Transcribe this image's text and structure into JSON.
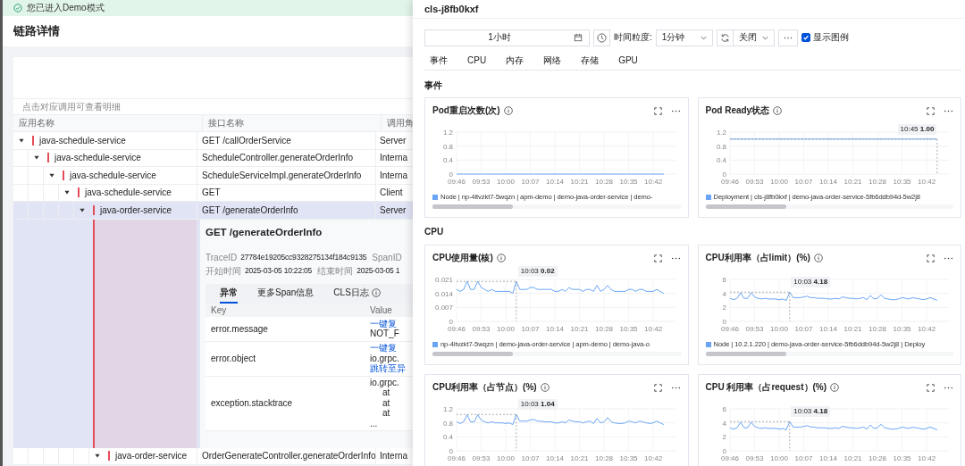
{
  "trace": {
    "banner": "您已进入Demo模式",
    "title": "链路详情",
    "hint": "点击对应调用可查看明细",
    "columns": [
      "应用名称",
      "接口名称",
      "调用角"
    ],
    "spans": [
      {
        "app": "java-schedule-service",
        "interface": "GET /callOrderService",
        "role": "Server",
        "expanded": true,
        "selected": false,
        "children": [
          {
            "app": "java-schedule-service",
            "interface": "ScheduleController.generateOrderInfo",
            "role": "Interna",
            "expanded": true,
            "selected": false,
            "children": [
              {
                "app": "java-schedule-service",
                "interface": "ScheduleServiceImpl.generateOrderInfo",
                "role": "Interna",
                "expanded": true,
                "selected": false,
                "children": [
                  {
                    "app": "java-schedule-service",
                    "interface": "GET",
                    "role": "Client",
                    "expanded": true,
                    "selected": false,
                    "children": [
                      {
                        "app": "java-order-service",
                        "interface": "GET /generateOrderInfo",
                        "role": "Server",
                        "expanded": true,
                        "selected": true,
                        "detail": {
                          "title": "GET /generateOrderInfo",
                          "meta": [
                            [
                              {
                                "label": "TraceID",
                                "value": "27784e19205cc9328275134f184c9135"
                              },
                              {
                                "label": "SpanID"
                              }
                            ],
                            [
                              {
                                "label": "开始时间",
                                "value": "2025-03-05 10:22:05"
                              },
                              {
                                "label": "结束时间",
                                "value": "2025-03-05 1"
                              }
                            ]
                          ],
                          "tabs": [
                            {
                              "label": "异常",
                              "selected": true
                            },
                            {
                              "label": "更多Span信息",
                              "selected": false
                            },
                            {
                              "label": "CLS日志",
                              "selected": false,
                              "info": true
                            }
                          ],
                          "columns": [
                            "Key",
                            "Value"
                          ],
                          "rows": [
                            {
                              "key": "error.message",
                              "value": [
                                {
                                  "kind": "link",
                                  "text": "一键复"
                                },
                                {
                                  "kind": "text",
                                  "text": "NOT_F"
                                }
                              ]
                            },
                            {
                              "key": "error.object",
                              "value": [
                                {
                                  "kind": "link",
                                  "text": "一键复"
                                },
                                {
                                  "kind": "text",
                                  "text": "io.grpc."
                                },
                                {
                                  "kind": "link",
                                  "text": "跳转至异"
                                }
                              ]
                            },
                            {
                              "key": "exception.stacktrace",
                              "value": [
                                {
                                  "kind": "text",
                                  "text": "io.grpc."
                                },
                                {
                                  "kind": "indent",
                                  "text": "at"
                                },
                                {
                                  "kind": "indent",
                                  "text": "at"
                                },
                                {
                                  "kind": "indent",
                                  "text": "at"
                                },
                                {
                                  "kind": "text",
                                  "text": "..."
                                }
                              ]
                            }
                          ]
                        },
                        "children": [
                          {
                            "app": "java-order-service",
                            "interface": "OrderGenerateController.generateOrderInfo",
                            "role": "Interna",
                            "expanded": true,
                            "selected": false
                          }
                        ]
                      }
                    ]
                  }
                ]
              }
            ]
          }
        ]
      }
    ]
  },
  "drawer": {
    "title": "cls-j8fb0kxf",
    "toolbar": {
      "time_range": "1小时",
      "granularity_label": "时间粒度:",
      "granularity": "1分钟",
      "auto_refresh": "关闭",
      "show_legend": {
        "label": "显示图例",
        "checked": true
      }
    },
    "tabs": [
      {
        "label": "事件",
        "selected": false
      },
      {
        "label": "CPU",
        "selected": false
      },
      {
        "label": "内存",
        "selected": false
      },
      {
        "label": "网络",
        "selected": false
      },
      {
        "label": "存储",
        "selected": false
      },
      {
        "label": "GPU",
        "selected": false
      }
    ],
    "sections": [
      {
        "title": "事件",
        "charts": [
          {
            "title": "Pod重启次数(次)",
            "chart_data": {
              "type": "line",
              "grid": true,
              "categories": [
                "09:46",
                null,
                null,
                null,
                null,
                null,
                null,
                "09:53",
                null,
                null,
                null,
                null,
                null,
                null,
                "10:00",
                null,
                null,
                null,
                null,
                null,
                null,
                "10:07",
                null,
                null,
                null,
                null,
                null,
                null,
                "10:14",
                null,
                null,
                null,
                null,
                null,
                null,
                "10:21",
                null,
                null,
                null,
                null,
                null,
                null,
                "10:28",
                null,
                null,
                null,
                null,
                null,
                null,
                "10:35",
                null,
                null,
                null,
                null,
                null,
                null,
                "10:42",
                null,
                null,
                null
              ],
              "series": [
                {
                  "name": "Node | np-4itvzkt7-5wqzn | apm-demo | demo-java-order-service | demo-",
                  "color": "#6aa5f5",
                  "values": [
                    0,
                    0,
                    0,
                    0,
                    0,
                    0,
                    0,
                    0,
                    0,
                    0,
                    0,
                    0,
                    0,
                    0,
                    0,
                    0,
                    0,
                    0,
                    0,
                    0,
                    0,
                    0,
                    0,
                    0,
                    0,
                    0,
                    0,
                    0,
                    0,
                    0,
                    0,
                    0,
                    0,
                    0,
                    0,
                    0,
                    0,
                    0,
                    0,
                    0,
                    0,
                    0,
                    0,
                    0,
                    0,
                    0,
                    0,
                    0,
                    0,
                    0,
                    0,
                    0,
                    0,
                    0,
                    0,
                    0,
                    0,
                    0,
                    0,
                    0
                  ]
                }
              ],
              "ylim": [
                0,
                1.2
              ],
              "yticks": [
                0,
                0.4,
                0.8,
                1.2
              ]
            }
          },
          {
            "title": "Pod Ready状态",
            "chart_data": {
              "type": "line",
              "grid": true,
              "categories": [
                "09:46",
                null,
                null,
                null,
                null,
                null,
                null,
                "09:53",
                null,
                null,
                null,
                null,
                null,
                null,
                "10:00",
                null,
                null,
                null,
                null,
                null,
                null,
                "10:07",
                null,
                null,
                null,
                null,
                null,
                null,
                "10:14",
                null,
                null,
                null,
                null,
                null,
                null,
                "10:21",
                null,
                null,
                null,
                null,
                null,
                null,
                "10:28",
                null,
                null,
                null,
                null,
                null,
                null,
                "10:35",
                null,
                null,
                null,
                null,
                null,
                null,
                "10:42",
                null,
                null,
                null
              ],
              "series": [
                {
                  "name": "Deployment | cls-j8fb0kxf | demo-java-order-service-5fb6ddb94d-5w2j8",
                  "color": "#6aa5f5",
                  "values": [
                    1,
                    1,
                    1,
                    1,
                    1,
                    1,
                    1,
                    1,
                    1,
                    1,
                    1,
                    1,
                    1,
                    1,
                    1,
                    1,
                    1,
                    1,
                    1,
                    1,
                    1,
                    1,
                    1,
                    1,
                    1,
                    1,
                    1,
                    1,
                    1,
                    1,
                    1,
                    1,
                    1,
                    1,
                    1,
                    1,
                    1,
                    1,
                    1,
                    1,
                    1,
                    1,
                    1,
                    1,
                    1,
                    1,
                    1,
                    1,
                    1,
                    1,
                    1,
                    1,
                    1,
                    1,
                    1,
                    1,
                    1,
                    1,
                    1,
                    1
                  ]
                }
              ],
              "ylim": [
                0,
                1.2
              ],
              "yticks": [
                0,
                0.4,
                0.8,
                1.2
              ],
              "annotations": [
                "10:45 **1.00**"
              ]
            }
          }
        ]
      },
      {
        "title": "CPU",
        "charts": [
          {
            "title": "CPU使用量(核)",
            "chart_data": {
              "type": "line",
              "grid": true,
              "categories": [
                "09:46",
                null,
                null,
                null,
                null,
                null,
                null,
                "09:53",
                null,
                null,
                null,
                null,
                null,
                null,
                "10:00",
                null,
                null,
                null,
                null,
                null,
                null,
                "10:07",
                null,
                null,
                null,
                null,
                null,
                null,
                "10:14",
                null,
                null,
                null,
                null,
                null,
                null,
                "10:21",
                null,
                null,
                null,
                null,
                null,
                null,
                "10:28",
                null,
                null,
                null,
                null,
                null,
                null,
                "10:35",
                null,
                null,
                null,
                null,
                null,
                null,
                "10:42",
                null,
                null,
                null
              ],
              "series": [
                {
                  "name": "np-4itvzkt7-5wqzn | demo-java-order-service | apm-demo | demo-java-o",
                  "color": "#6aa5f5",
                  "values": [
                    0.016,
                    0.015,
                    0.016,
                    0.02,
                    0.016,
                    0.016,
                    0.02,
                    0.017,
                    0.016,
                    0.015,
                    0.016,
                    0.015,
                    0.015,
                    0.015,
                    0.015,
                    0.015,
                    0.014,
                    0.02,
                    0.016,
                    0.016,
                    0.016,
                    0.017,
                    0.017,
                    0.016,
                    0.016,
                    0.016,
                    0.016,
                    0.016,
                    0.015,
                    0.015,
                    0.016,
                    0.015,
                    0.017,
                    0.016,
                    0.016,
                    0.016,
                    0.015,
                    0.016,
                    0.016,
                    0.015,
                    0.018,
                    0.015,
                    0.016,
                    0.018,
                    0.016,
                    0.015,
                    0.015,
                    0.015,
                    0.015,
                    0.016,
                    0.016,
                    0.015,
                    0.016,
                    0.016,
                    0.015,
                    0.015,
                    0.015,
                    0.016,
                    0.015,
                    0.014
                  ]
                }
              ],
              "ylim": [
                0,
                0.021
              ],
              "yticks": [
                0,
                0.007,
                0.014,
                0.021
              ],
              "annotations": [
                "10:03 **0.02**"
              ]
            }
          },
          {
            "title": "CPU利用率（占limit）(%)",
            "chart_data": {
              "type": "line",
              "grid": true,
              "categories": [
                "09:46",
                null,
                null,
                null,
                null,
                null,
                null,
                "09:53",
                null,
                null,
                null,
                null,
                null,
                null,
                "10:00",
                null,
                null,
                null,
                null,
                null,
                null,
                "10:07",
                null,
                null,
                null,
                null,
                null,
                null,
                "10:14",
                null,
                null,
                null,
                null,
                null,
                null,
                "10:21",
                null,
                null,
                null,
                null,
                null,
                null,
                "10:28",
                null,
                null,
                null,
                null,
                null,
                null,
                "10:35",
                null,
                null,
                null,
                null,
                null,
                null,
                "10:42",
                null,
                null,
                null
              ],
              "series": [
                {
                  "name": "Node | 10.2.1.220 | demo-java-order-service-5fb6ddb94d-5w2j8 | Deploy",
                  "color": "#6aa5f5",
                  "values": [
                    3.3,
                    3.1,
                    3.3,
                    4.1,
                    3.3,
                    3.3,
                    4.1,
                    3.5,
                    3.3,
                    3.2,
                    3.3,
                    3.2,
                    3.2,
                    3.2,
                    3.1,
                    3.2,
                    3.0,
                    4.18,
                    3.4,
                    3.4,
                    3.4,
                    3.5,
                    3.6,
                    3.4,
                    3.4,
                    3.3,
                    3.3,
                    3.3,
                    3.2,
                    3.2,
                    3.3,
                    3.2,
                    3.5,
                    3.4,
                    3.3,
                    3.3,
                    3.2,
                    3.3,
                    3.4,
                    3.1,
                    3.7,
                    3.2,
                    3.3,
                    3.8,
                    3.3,
                    3.2,
                    3.1,
                    3.1,
                    3.2,
                    3.4,
                    3.3,
                    3.2,
                    3.4,
                    3.3,
                    3.2,
                    3.1,
                    3.2,
                    3.4,
                    3.2,
                    3.0
                  ]
                }
              ],
              "ylim": [
                0,
                6
              ],
              "yticks": [
                0,
                2,
                4,
                6
              ],
              "annotations": [
                "10:03 **4.18**"
              ]
            }
          },
          {
            "title": "CPU利用率（占节点）(%)",
            "chart_data": {
              "type": "line",
              "grid": true,
              "categories": [
                "09:46",
                null,
                null,
                null,
                null,
                null,
                null,
                "09:53",
                null,
                null,
                null,
                null,
                null,
                null,
                "10:00",
                null,
                null,
                null,
                null,
                null,
                null,
                "10:07",
                null,
                null,
                null,
                null,
                null,
                null,
                "10:14",
                null,
                null,
                null,
                null,
                null,
                null,
                "10:21",
                null,
                null,
                null,
                null,
                null,
                null,
                "10:28",
                null,
                null,
                null,
                null,
                null,
                null,
                "10:35",
                null,
                null,
                null,
                null,
                null,
                null,
                "10:42",
                null,
                null,
                null
              ],
              "series": [
                {
                  "color": "#6aa5f5",
                  "values": [
                    0.83,
                    0.78,
                    0.83,
                    1.03,
                    0.83,
                    0.83,
                    1.03,
                    0.88,
                    0.83,
                    0.8,
                    0.83,
                    0.8,
                    0.8,
                    0.8,
                    0.78,
                    0.8,
                    0.75,
                    1.04,
                    0.85,
                    0.85,
                    0.85,
                    0.88,
                    0.9,
                    0.85,
                    0.85,
                    0.83,
                    0.83,
                    0.83,
                    0.8,
                    0.8,
                    0.83,
                    0.8,
                    0.88,
                    0.85,
                    0.83,
                    0.83,
                    0.8,
                    0.83,
                    0.85,
                    0.78,
                    0.93,
                    0.8,
                    0.83,
                    0.95,
                    0.83,
                    0.8,
                    0.78,
                    0.78,
                    0.8,
                    0.85,
                    0.83,
                    0.8,
                    0.85,
                    0.83,
                    0.8,
                    0.78,
                    0.8,
                    0.85,
                    0.8,
                    0.75
                  ]
                }
              ],
              "ylim": [
                0,
                1.2
              ],
              "yticks": [
                0,
                0.4,
                0.8,
                1.2
              ],
              "annotations": [
                "10:03 **1.04**"
              ]
            }
          },
          {
            "title": "CPU 利用率（占request）(%)",
            "chart_data": {
              "type": "line",
              "grid": true,
              "categories": [
                "09:46",
                null,
                null,
                null,
                null,
                null,
                null,
                "09:53",
                null,
                null,
                null,
                null,
                null,
                null,
                "10:00",
                null,
                null,
                null,
                null,
                null,
                null,
                "10:07",
                null,
                null,
                null,
                null,
                null,
                null,
                "10:14",
                null,
                null,
                null,
                null,
                null,
                null,
                "10:21",
                null,
                null,
                null,
                null,
                null,
                null,
                "10:28",
                null,
                null,
                null,
                null,
                null,
                null,
                "10:35",
                null,
                null,
                null,
                null,
                null,
                null,
                "10:42",
                null,
                null,
                null
              ],
              "series": [
                {
                  "color": "#6aa5f5",
                  "values": [
                    3.3,
                    3.1,
                    3.3,
                    4.1,
                    3.3,
                    3.3,
                    4.1,
                    3.5,
                    3.3,
                    3.2,
                    3.3,
                    3.2,
                    3.2,
                    3.2,
                    3.1,
                    3.2,
                    3.0,
                    4.18,
                    3.4,
                    3.4,
                    3.4,
                    3.5,
                    3.6,
                    3.4,
                    3.4,
                    3.3,
                    3.3,
                    3.3,
                    3.2,
                    3.2,
                    3.3,
                    3.2,
                    3.5,
                    3.4,
                    3.3,
                    3.3,
                    3.2,
                    3.3,
                    3.4,
                    3.1,
                    3.7,
                    3.2,
                    3.3,
                    3.8,
                    3.3,
                    3.2,
                    3.1,
                    3.1,
                    3.2,
                    3.4,
                    3.3,
                    3.2,
                    3.4,
                    3.3,
                    3.2,
                    3.1,
                    3.2,
                    3.4,
                    3.2,
                    3.0
                  ]
                }
              ],
              "ylim": [
                0,
                6
              ],
              "yticks": [
                0,
                2,
                4,
                6
              ],
              "annotations": [
                "10:03 **4.18**"
              ]
            }
          }
        ]
      }
    ]
  }
}
